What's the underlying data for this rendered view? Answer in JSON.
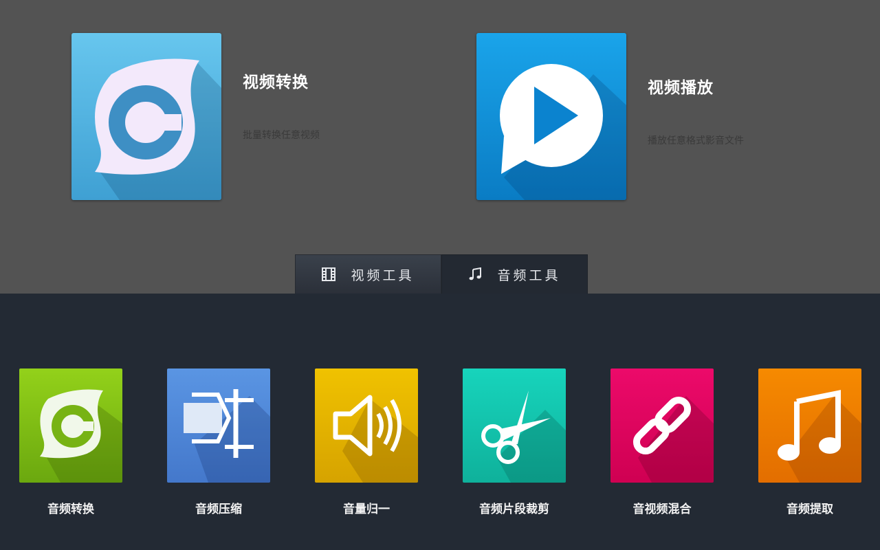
{
  "features": [
    {
      "title": "视频转换",
      "desc": "批量转换任意视频",
      "icon": "convert-icon",
      "color": "#4fb3e2"
    },
    {
      "title": "视频播放",
      "desc": "播放任意格式影音文件",
      "icon": "play-icon",
      "color": "#1496dd"
    }
  ],
  "tabs": {
    "video": {
      "label": "视频工具",
      "icon": "film-icon"
    },
    "audio": {
      "label": "音频工具",
      "icon": "music-note-icon",
      "selected": true
    }
  },
  "tools": [
    {
      "label": "音频转换",
      "icon": "convert-icon",
      "color": "#7bbd13"
    },
    {
      "label": "音频压缩",
      "icon": "compress-icon",
      "color": "#4e87d8"
    },
    {
      "label": "音量归一",
      "icon": "speaker-icon",
      "color": "#e7b800"
    },
    {
      "label": "音频片段裁剪",
      "icon": "scissors-icon",
      "color": "#12c3ad"
    },
    {
      "label": "音视频混合",
      "icon": "link-icon",
      "color": "#e4005b"
    },
    {
      "label": "音频提取",
      "icon": "music-note-icon",
      "color": "#ef7c00"
    }
  ]
}
